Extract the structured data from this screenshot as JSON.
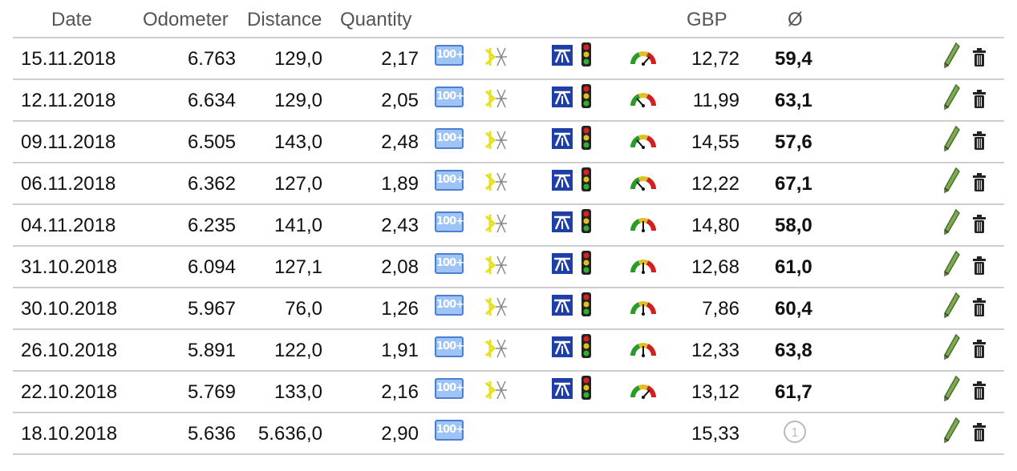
{
  "headers": {
    "date": "Date",
    "odometer": "Odometer",
    "distance": "Distance",
    "quantity": "Quantity",
    "currency": "GBP",
    "average": "Ø"
  },
  "rows": [
    {
      "date": "15.11.2018",
      "odometer": "6.763",
      "distance": "129,0",
      "quantity": "2,17",
      "cost": "12,72",
      "avg": "59,4",
      "full_icons": true,
      "gauge": "red"
    },
    {
      "date": "12.11.2018",
      "odometer": "6.634",
      "distance": "129,0",
      "quantity": "2,05",
      "cost": "11,99",
      "avg": "63,1",
      "full_icons": true,
      "gauge": "green"
    },
    {
      "date": "09.11.2018",
      "odometer": "6.505",
      "distance": "143,0",
      "quantity": "2,48",
      "cost": "14,55",
      "avg": "57,6",
      "full_icons": true,
      "gauge": "green"
    },
    {
      "date": "06.11.2018",
      "odometer": "6.362",
      "distance": "127,0",
      "quantity": "1,89",
      "cost": "12,22",
      "avg": "67,1",
      "full_icons": true,
      "gauge": "green"
    },
    {
      "date": "04.11.2018",
      "odometer": "6.235",
      "distance": "141,0",
      "quantity": "2,43",
      "cost": "14,80",
      "avg": "58,0",
      "full_icons": true,
      "gauge": "mid"
    },
    {
      "date": "31.10.2018",
      "odometer": "6.094",
      "distance": "127,1",
      "quantity": "2,08",
      "cost": "12,68",
      "avg": "61,0",
      "full_icons": true,
      "gauge": "mid"
    },
    {
      "date": "30.10.2018",
      "odometer": "5.967",
      "distance": "76,0",
      "quantity": "1,26",
      "cost": "7,86",
      "avg": "60,4",
      "full_icons": true,
      "gauge": "mid"
    },
    {
      "date": "26.10.2018",
      "odometer": "5.891",
      "distance": "122,0",
      "quantity": "1,91",
      "cost": "12,33",
      "avg": "63,8",
      "full_icons": true,
      "gauge": "mid"
    },
    {
      "date": "22.10.2018",
      "odometer": "5.769",
      "distance": "133,0",
      "quantity": "2,16",
      "cost": "13,12",
      "avg": "61,7",
      "full_icons": true,
      "gauge": "red"
    },
    {
      "date": "18.10.2018",
      "odometer": "5.636",
      "distance": "5.636,0",
      "quantity": "2,90",
      "cost": "15,33",
      "avg": "1",
      "full_icons": false,
      "gauge": ""
    }
  ],
  "icons": {
    "fuel_label": "100+",
    "fuel_icon": "fuel-type-100-icon",
    "climate_icon": "air-conditioning-icon",
    "motorway_icon": "motorway-icon",
    "traffic_icon": "traffic-light-icon",
    "gauge_icon": "driving-style-gauge-icon",
    "edit_icon": "pencil-edit-icon",
    "delete_icon": "trash-delete-icon",
    "first_icon": "first-entry-circle-icon"
  },
  "colors": {
    "border": "#cfcfcf",
    "header_text": "#555555",
    "fuel_blue": "#9ec4f5",
    "motorway_blue": "#1e3fa6",
    "climate_yellow": "#e8e01a",
    "pencil_green": "#6e9a4a"
  }
}
